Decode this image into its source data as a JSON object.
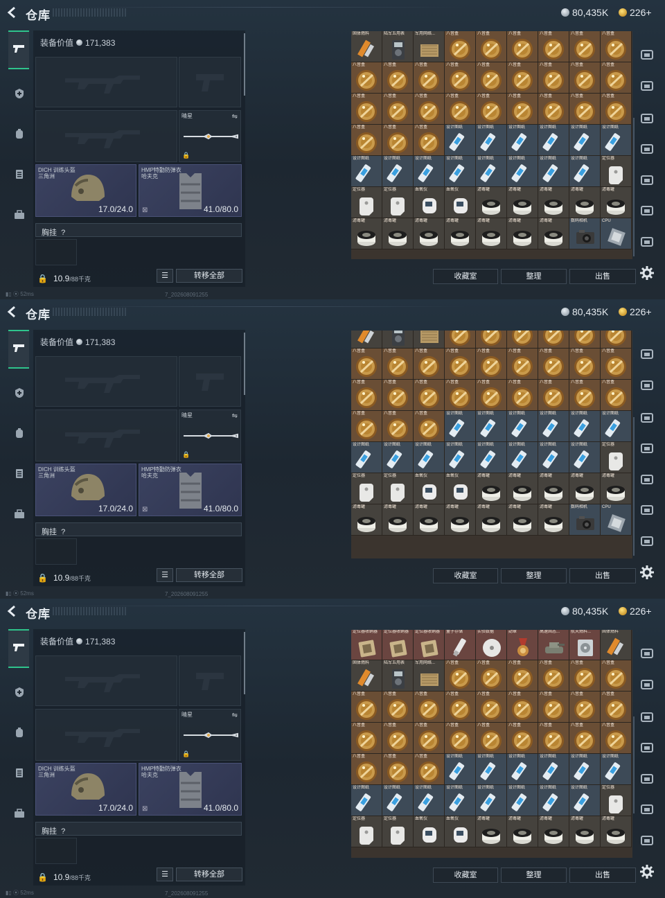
{
  "header": {
    "title": "仓库",
    "silver": "80,435K",
    "gold": "226+"
  },
  "nav": {
    "items": [
      "pistol-icon",
      "medic-icon",
      "backpack-icon",
      "clipboard-icon",
      "briefcase-icon"
    ]
  },
  "equipment": {
    "value_label": "装备价值",
    "value": "171,383",
    "melee_label": "晴星",
    "helmet_label": "DICH 训练头盔",
    "helmet_sub": "三角洲",
    "helmet_durability": "17.0/24.0",
    "armor_label": "HMP特勤防弹衣",
    "armor_sub": "哈夫克",
    "armor_durability": "41.0/80.0",
    "chest_label": "胸挂",
    "chest_hint": "?",
    "weight": "10.9",
    "weight_max": "/88千克",
    "transfer_all": "转移全部"
  },
  "storage": {
    "buttons": [
      "收藏室",
      "整理",
      "出售"
    ],
    "row_extra": [
      {
        "label": "定位器收纳器",
        "type": "locator-case"
      },
      {
        "label": "定位器收纳器",
        "type": "locator-case"
      },
      {
        "label": "定位器收纳器",
        "type": "locator-case"
      },
      {
        "label": "量子存储",
        "type": "usb"
      },
      {
        "label": "实验数据",
        "type": "disc"
      },
      {
        "label": "勋章",
        "type": "medal"
      },
      {
        "label": "高速固态...",
        "type": "tank"
      },
      {
        "label": "航天燃料...",
        "type": "drive"
      },
      {
        "label": "固体燃料",
        "type": "fuel"
      }
    ],
    "row_first": [
      {
        "label": "固体燃料",
        "type": "fuel"
      },
      {
        "label": "陆军五用表",
        "type": "meter"
      },
      {
        "label": "军用网络...",
        "type": "net"
      },
      {
        "label": "八音盒",
        "type": "coin"
      },
      {
        "label": "八音盒",
        "type": "coin"
      },
      {
        "label": "八音盒",
        "type": "coin"
      },
      {
        "label": "八音盒",
        "type": "coin"
      },
      {
        "label": "八音盒",
        "type": "coin"
      },
      {
        "label": "八音盒",
        "type": "coin"
      }
    ],
    "rows_coin": [
      [
        "八音盒",
        "八音盒",
        "八音盒",
        "八音盒",
        "八音盒",
        "八音盒",
        "八音盒",
        "八音盒",
        "八音盒"
      ],
      [
        "八音盒",
        "八音盒",
        "八音盒",
        "八音盒",
        "八音盒",
        "八音盒",
        "八音盒",
        "八音盒",
        "八音盒"
      ]
    ],
    "row_mixed": [
      {
        "label": "八音盒",
        "type": "coin"
      },
      {
        "label": "八音盒",
        "type": "coin"
      },
      {
        "label": "八音盒",
        "type": "coin"
      },
      {
        "label": "设计图纸",
        "type": "blueprint"
      },
      {
        "label": "设计图纸",
        "type": "blueprint"
      },
      {
        "label": "设计图纸",
        "type": "blueprint"
      },
      {
        "label": "设计图纸",
        "type": "blueprint"
      },
      {
        "label": "设计图纸",
        "type": "blueprint"
      },
      {
        "label": "设计图纸",
        "type": "blueprint"
      }
    ],
    "row_blueprint": [
      {
        "label": "设计图纸",
        "type": "blueprint"
      },
      {
        "label": "设计图纸",
        "type": "blueprint"
      },
      {
        "label": "设计图纸",
        "type": "blueprint"
      },
      {
        "label": "设计图纸",
        "type": "blueprint"
      },
      {
        "label": "设计图纸",
        "type": "blueprint"
      },
      {
        "label": "设计图纸",
        "type": "blueprint"
      },
      {
        "label": "设计图纸",
        "type": "blueprint"
      },
      {
        "label": "设计图纸",
        "type": "blueprint"
      },
      {
        "label": "定位器",
        "type": "locator"
      }
    ],
    "row_locator": [
      {
        "label": "定位器",
        "type": "locator"
      },
      {
        "label": "定位器",
        "type": "locator"
      },
      {
        "label": "血氧仪",
        "type": "oximeter"
      },
      {
        "label": "血氧仪",
        "type": "oximeter"
      },
      {
        "label": "滤毒罐",
        "type": "filter"
      },
      {
        "label": "滤毒罐",
        "type": "filter"
      },
      {
        "label": "滤毒罐",
        "type": "filter"
      },
      {
        "label": "滤毒罐",
        "type": "filter"
      },
      {
        "label": "滤毒罐",
        "type": "filter"
      }
    ],
    "row_last": [
      {
        "label": "滤毒罐",
        "type": "filter"
      },
      {
        "label": "滤毒罐",
        "type": "filter"
      },
      {
        "label": "滤毒罐",
        "type": "filter"
      },
      {
        "label": "滤毒罐",
        "type": "filter"
      },
      {
        "label": "滤毒罐",
        "type": "filter"
      },
      {
        "label": "滤毒罐",
        "type": "filter"
      },
      {
        "label": "滤毒罐",
        "type": "filter"
      },
      {
        "label": "数码相机",
        "type": "camera"
      },
      {
        "label": "CPU",
        "type": "cpu"
      }
    ]
  },
  "status": {
    "ping": "52ms",
    "build": "7_202608091255"
  },
  "colors": {
    "accent": "#2fc48c",
    "panel_bg": "#1d2731",
    "armor_slot": "#3b4260",
    "coin_cell": "#6a4e35"
  }
}
